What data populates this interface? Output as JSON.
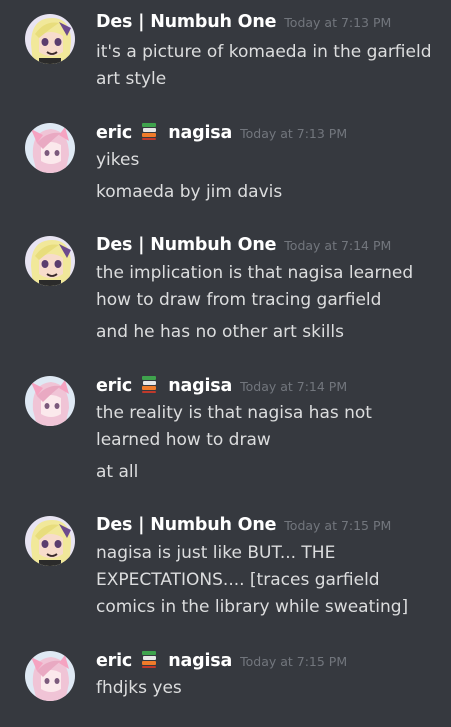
{
  "messages": [
    {
      "author": "Des | Numbuh One",
      "avatar_icon": "anime-avatar-blond-icon",
      "timestamp": "Today at 7:13 PM",
      "lines": [
        "it's a picture of komaeda in the garfield  art style"
      ]
    },
    {
      "author_prefix": "eric",
      "author_badge_icon": "books-emoji-icon",
      "author_suffix": "nagisa",
      "avatar_icon": "anime-avatar-pink-icon",
      "timestamp": "Today at 7:13 PM",
      "lines": [
        "yikes",
        "komaeda by jim davis"
      ]
    },
    {
      "author": "Des | Numbuh One",
      "avatar_icon": "anime-avatar-blond-icon",
      "timestamp": "Today at 7:14 PM",
      "lines": [
        "the implication is that nagisa learned how to draw from tracing garfield",
        "and he has no other art skills"
      ]
    },
    {
      "author_prefix": "eric",
      "author_badge_icon": "books-emoji-icon",
      "author_suffix": "nagisa",
      "avatar_icon": "anime-avatar-pink-icon",
      "timestamp": "Today at 7:14 PM",
      "lines": [
        "the reality is that nagisa has not learned how to draw",
        "at all"
      ]
    },
    {
      "author": "Des | Numbuh One",
      "avatar_icon": "anime-avatar-blond-icon",
      "timestamp": "Today at 7:15 PM",
      "lines": [
        "nagisa is just like BUT... THE EXPECTATIONS.... [traces garfield comics in the library while sweating]"
      ]
    },
    {
      "author_prefix": "eric",
      "author_badge_icon": "books-emoji-icon",
      "author_suffix": "nagisa",
      "avatar_icon": "anime-avatar-pink-icon",
      "timestamp": "Today at 7:15 PM",
      "lines": [
        "fhdjks yes"
      ]
    }
  ],
  "colors": {
    "background": "#36393f",
    "username": "#ffffff",
    "timestamp": "#72767d",
    "text": "#dcddde"
  }
}
